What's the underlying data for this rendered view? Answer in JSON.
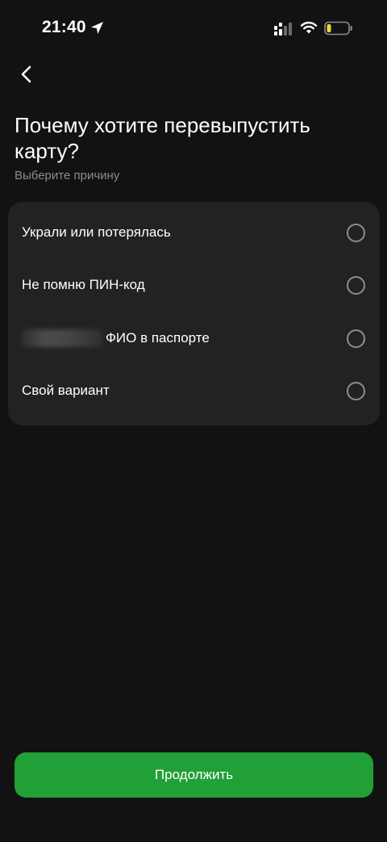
{
  "status_bar": {
    "time": "21:40",
    "icons": [
      "location-arrow-icon",
      "signal-icon",
      "wifi-icon",
      "battery-low-icon"
    ],
    "battery_color": "#f2d53c"
  },
  "header": {
    "back_icon": "chevron-left-icon",
    "title": "Почему хотите перевыпустить карту?",
    "subtitle": "Выберите причину"
  },
  "options": [
    {
      "label": "Украли или потерялась",
      "selected": false
    },
    {
      "label": "Не помню ПИН-код",
      "selected": false
    },
    {
      "label": "ФИО в паспорте",
      "selected": false,
      "redacted_prefix": true
    },
    {
      "label": "Свой вариант",
      "selected": false
    }
  ],
  "footer": {
    "continue_label": "Продолжить"
  },
  "colors": {
    "background": "#121212",
    "card": "#222222",
    "accent": "#21a038",
    "subtitle": "#8c8c8c",
    "radio": "#8e8e8e"
  }
}
